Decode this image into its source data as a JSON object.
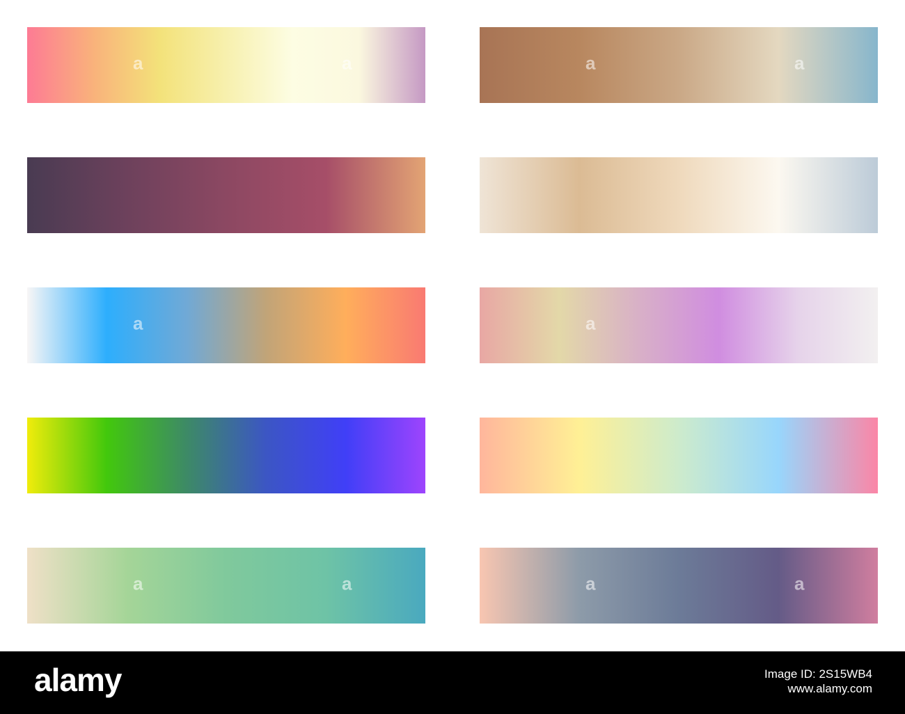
{
  "watermark": {
    "glyph": "a"
  },
  "swatches": [
    {
      "colors": [
        "#fd7b94",
        "#f9b27b",
        "#f3e27a",
        "#f7f0ae",
        "#fdfde3",
        "#fbf8df",
        "#c599c4"
      ]
    },
    {
      "colors": [
        "#a87455",
        "#b8875f",
        "#caa886",
        "#e4d8c0",
        "#87b6cc"
      ]
    },
    {
      "colors": [
        "#493b52",
        "#6d415c",
        "#8c4862",
        "#a64e68",
        "#e3a474"
      ]
    },
    {
      "colors": [
        "#efe4d6",
        "#dbbb94",
        "#efd9bc",
        "#fcf8f0",
        "#bccbd8"
      ]
    },
    {
      "colors": [
        "#f8f6f6",
        "#2daefd",
        "#70a9d6",
        "#c1a478",
        "#ffae5b",
        "#f97a72"
      ]
    },
    {
      "colors": [
        "#e8a7a4",
        "#e3d8a8",
        "#d8b0c7",
        "#d08de0",
        "#e6d3ea",
        "#f2f0f0"
      ]
    },
    {
      "colors": [
        "#f0ec0c",
        "#42c80c",
        "#3d8a66",
        "#3c56c4",
        "#403ff7",
        "#9e44fd"
      ]
    },
    {
      "colors": [
        "#ffb69c",
        "#fff095",
        "#cdebcc",
        "#98d6fc",
        "#fb86a6"
      ]
    },
    {
      "colors": [
        "#efe0c7",
        "#a5d598",
        "#80c99c",
        "#6ec3a6",
        "#4aa9bf"
      ]
    },
    {
      "colors": [
        "#f8c6b1",
        "#8d9ba9",
        "#6c7b98",
        "#645b87",
        "#d07e9f"
      ]
    }
  ],
  "footer": {
    "logo": "alamy",
    "image_id": "Image ID: 2S15WB4",
    "site": "www.alamy.com"
  }
}
